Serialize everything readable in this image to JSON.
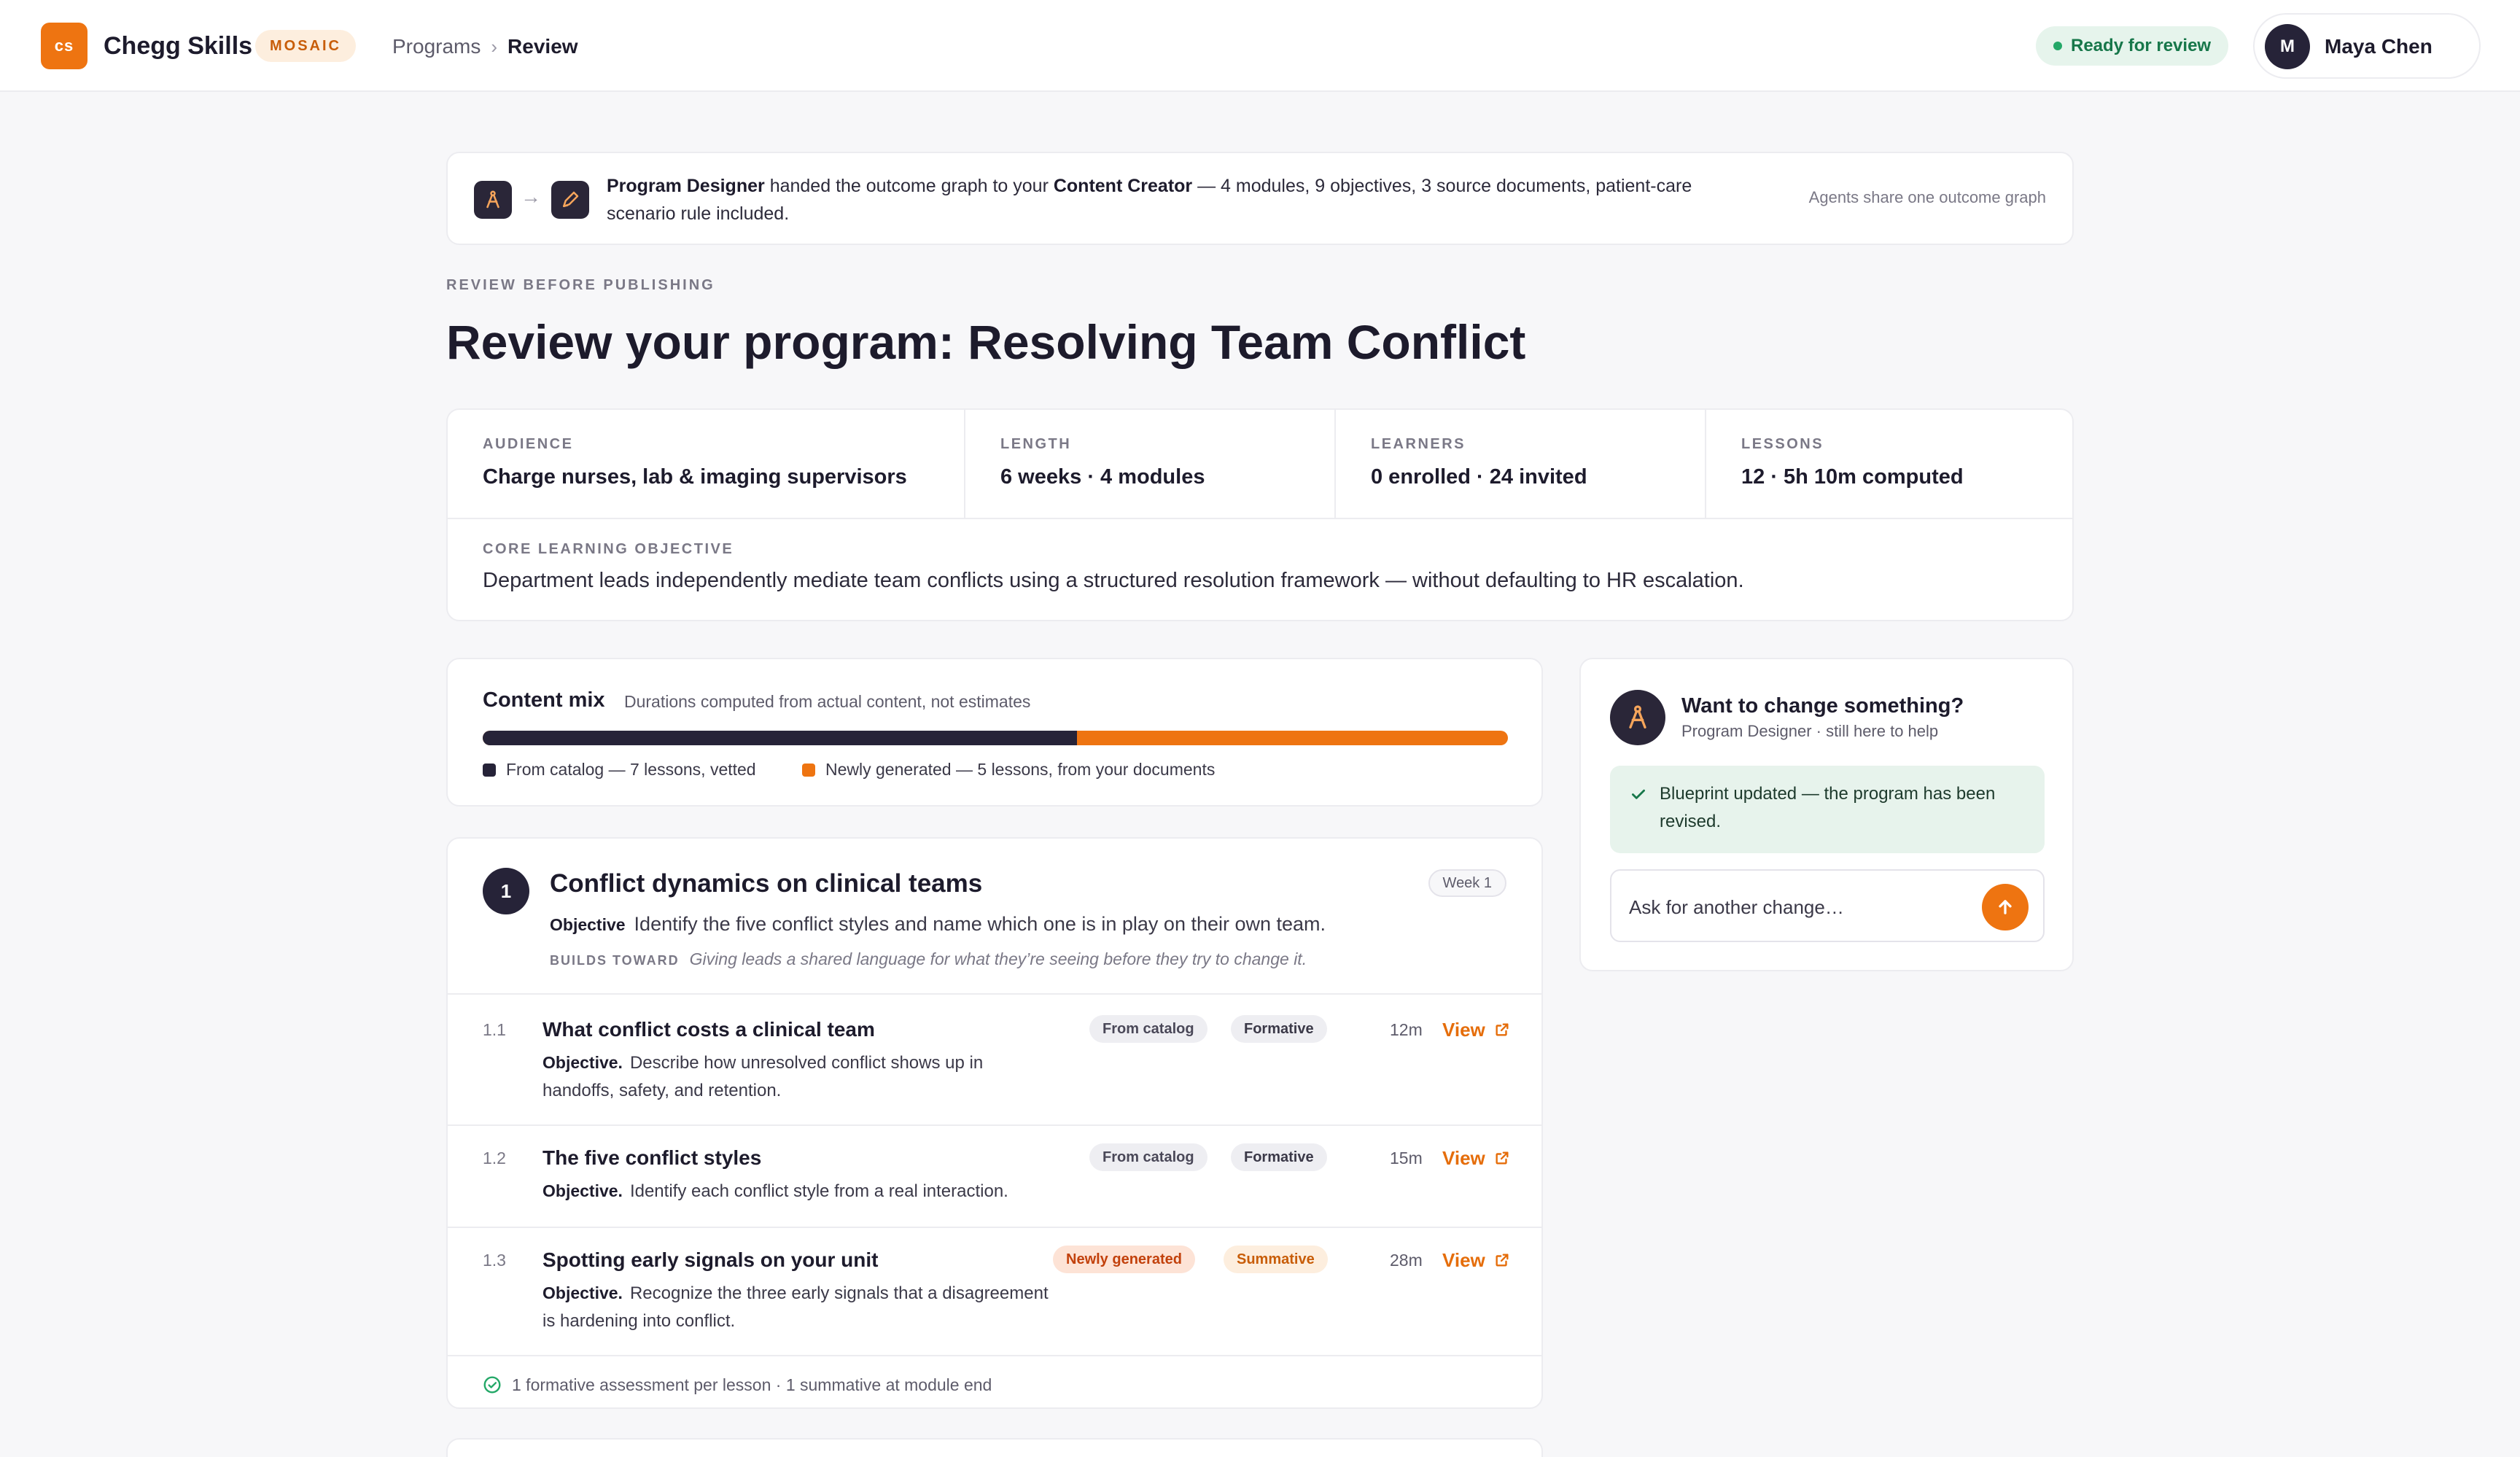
{
  "colors": {
    "accent": "#ee7411",
    "dark": "#262338",
    "success": "#24a868"
  },
  "topbar": {
    "logo_text": "cs",
    "app_name": "Chegg Skills",
    "badge": "MOSAIC",
    "breadcrumb": [
      "Programs",
      "Review"
    ],
    "status": "Ready for review",
    "user": {
      "initial": "M",
      "name": "Maya Chen"
    }
  },
  "handoff": {
    "from_agent": "Program Designer",
    "text_middle": " handed the outcome graph to your ",
    "to_agent": "Content Creator",
    "text_rest": " — 4 modules, 9 objectives, 3 source documents, patient-care scenario rule included.",
    "note": "Agents share one outcome graph",
    "icons": [
      "compass-icon",
      "pencil-icon"
    ]
  },
  "page": {
    "eyebrow": "REVIEW BEFORE PUBLISHING",
    "title_prefix": "Review your program: ",
    "title_program": "Resolving Team Conflict"
  },
  "facts": [
    {
      "label": "AUDIENCE",
      "value": "Charge nurses, lab & imaging supervisors"
    },
    {
      "label": "LENGTH",
      "value": "6 weeks · 4 modules"
    },
    {
      "label": "LEARNERS",
      "value": "0 enrolled · 24 invited"
    },
    {
      "label": "LESSONS",
      "value": "12 · 5h 10m computed"
    }
  ],
  "core_objective": {
    "label": "CORE LEARNING OBJECTIVE",
    "text": "Department leads independently mediate team conflicts using a structured resolution framework — without defaulting to HR escalation."
  },
  "content_mix": {
    "title": "Content mix",
    "subtitle": "Durations computed from actual content, not estimates",
    "catalog_fraction": 0.58,
    "legend": [
      "From catalog — 7 lessons, vetted",
      "Newly generated — 5 lessons, from your documents"
    ]
  },
  "module": {
    "number": "1",
    "title": "Conflict dynamics on clinical teams",
    "week": "Week 1",
    "objective_label": "Objective",
    "objective": "Identify the five conflict styles and name which one is in play on their own team.",
    "builds_label": "BUILDS TOWARD",
    "builds_text": "Giving leads a shared language for what they’re seeing before they try to change it.",
    "lessons": [
      {
        "no": "1.1",
        "title": "What conflict costs a clinical team",
        "objective_label": "Objective.",
        "objective": "Describe how unresolved conflict shows up in handoffs, safety, and retention.",
        "source": "From catalog",
        "assessment": "Formative",
        "duration": "12m",
        "view": "View"
      },
      {
        "no": "1.2",
        "title": "The five conflict styles",
        "objective_label": "Objective.",
        "objective": "Identify each conflict style from a real interaction.",
        "source": "From catalog",
        "assessment": "Formative",
        "duration": "15m",
        "view": "View"
      },
      {
        "no": "1.3",
        "title": "Spotting early signals on your unit",
        "objective_label": "Objective.",
        "objective": "Recognize the three early signals that a disagreement is hardening into conflict.",
        "source": "Newly generated",
        "assessment": "Summative",
        "duration": "28m",
        "view": "View"
      }
    ],
    "footer": "1 formative assessment per lesson · 1 summative at module end"
  },
  "assistant": {
    "title": "Want to change something?",
    "subtitle": "Program Designer · still here to help",
    "message": "Blueprint updated — the program has been revised.",
    "input_placeholder": "Ask for another change…"
  }
}
